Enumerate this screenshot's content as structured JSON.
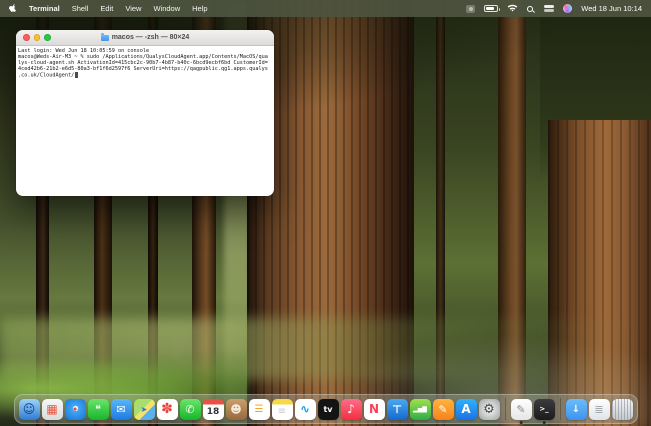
{
  "menu_bar": {
    "menus": [
      "Terminal",
      "Shell",
      "Edit",
      "View",
      "Window",
      "Help"
    ],
    "clock": "Wed 18 Jun 10:14",
    "status_icons": [
      "menu-extra",
      "battery",
      "wifi",
      "spotlight",
      "control-center",
      "siri"
    ]
  },
  "terminal_window": {
    "title": "macos — -zsh — 80×24",
    "lines": [
      "Last login: Wed Jun 18 10:05:59 on console",
      "macos@Weds-Air-M3 ~ % sudo /Applications/QualysCloudAgent.app/Contents/MacOS/qua",
      "lys-cloud-agent.sh ActivationId=415cbc2c-90b7-4b87-b40c-6bcd9ecbf6bd CustomerId=",
      "4ced42b6-21b2-e6d5-80a3-bf1f6d2597f6 ServerUri=https://qagpublic.qg1.apps.qualys",
      ".co.uk/CloudAgent/"
    ],
    "cursor_visible": true
  },
  "colors": {
    "menubar_bg": "#4e543f",
    "traffic_red": "#ff5f57",
    "traffic_yellow": "#febc2e",
    "traffic_green": "#28c840",
    "terminal_text": "#161616"
  },
  "dock": {
    "items": [
      {
        "name": "finder",
        "glyph": "☺",
        "bg": "linear-gradient(180deg,#9fd2f7,#2e7cd6)",
        "fg": "#0b3f7e",
        "fs": 12
      },
      {
        "name": "launchpad",
        "glyph": "▦",
        "bg": "linear-gradient(180deg,#f7f7f7,#d9dadc)",
        "fg": "#e8563f",
        "fs": 12
      },
      {
        "name": "safari",
        "glyph": "✦",
        "bg": "radial-gradient(circle at 50% 45%,#eaf6ff 16%,#3fa9f5 18%,#1a6fd4)",
        "fg": "#e8453c",
        "fs": 8
      },
      {
        "name": "messages",
        "glyph": "❝",
        "bg": "linear-gradient(180deg,#6be36b,#15b729)",
        "fg": "#ffffff",
        "fs": 11
      },
      {
        "name": "mail",
        "glyph": "✉",
        "bg": "linear-gradient(180deg,#59b6f8,#1d7ae4)",
        "fg": "#ffffff",
        "fs": 11
      },
      {
        "name": "maps",
        "glyph": "➤",
        "bg": "linear-gradient(135deg,#a9dd6d 45%,#f3e26b 45%,#f3e26b 62%,#59b1f2 62%)",
        "fg": "#2f6fe4",
        "fs": 8
      },
      {
        "name": "photos",
        "glyph": "✽",
        "bg": "#ffffff",
        "fg": "#e8453c",
        "fs": 14
      },
      {
        "name": "facetime",
        "glyph": "✆",
        "bg": "linear-gradient(180deg,#6be36b,#15b729)",
        "fg": "#ffffff",
        "fs": 11
      },
      {
        "name": "calendar",
        "glyph": "18",
        "bg": "linear-gradient(180deg,#ec5044 0,#ec5044 26%,#ffffff 26%)",
        "fg": "#333333",
        "fs": 9,
        "pad": 5,
        "bold": true
      },
      {
        "name": "contacts",
        "glyph": "☻",
        "bg": "linear-gradient(180deg,#cb9e6b,#96683c)",
        "fg": "#f4e9d8",
        "fs": 11
      },
      {
        "name": "reminders",
        "glyph": "☰",
        "bg": "#ffffff",
        "fg": "#f5a623",
        "fs": 10
      },
      {
        "name": "notes",
        "glyph": "≡",
        "bg": "linear-gradient(180deg,#f7d947 0,#f7d947 27%,#ffffff 27%)",
        "fg": "#c9c9c9",
        "fs": 10,
        "pad": 4
      },
      {
        "name": "freeform",
        "glyph": "∿",
        "bg": "#ffffff",
        "fg": "#18a0ea",
        "fs": 12,
        "bold": true
      },
      {
        "name": "tv",
        "glyph": "tv",
        "bg": "#141414",
        "fg": "#ffffff",
        "fs": 8,
        "bold": true
      },
      {
        "name": "music",
        "glyph": "♪",
        "bg": "linear-gradient(180deg,#fd6e8a,#f52d3f)",
        "fg": "#ffffff",
        "fs": 12
      },
      {
        "name": "news",
        "glyph": "N",
        "bg": "#ffffff",
        "fg": "#fb415b",
        "fs": 12,
        "bold": true
      },
      {
        "name": "keynote",
        "glyph": "⊤",
        "bg": "linear-gradient(180deg,#4aa8f2,#1469cc)",
        "fg": "#ffffff",
        "fs": 11,
        "bold": true
      },
      {
        "name": "numbers",
        "glyph": "▂▅▇",
        "bg": "linear-gradient(180deg,#9ee04f,#2fae45)",
        "fg": "#ffffff",
        "fs": 6
      },
      {
        "name": "pages",
        "glyph": "✎",
        "bg": "linear-gradient(180deg,#ffb340,#f7821b)",
        "fg": "#ffffff",
        "fs": 11
      },
      {
        "name": "appstore",
        "glyph": "A",
        "bg": "linear-gradient(180deg,#30b0fb,#1a71e8)",
        "fg": "#ffffff",
        "fs": 12,
        "bold": true
      },
      {
        "name": "settings",
        "glyph": "⚙",
        "bg": "radial-gradient(circle,#ececec 15%,#9fa0a2)",
        "fg": "#4a4a4a",
        "fs": 13
      },
      {
        "divider": true
      },
      {
        "name": "textedit",
        "glyph": "✎",
        "bg": "linear-gradient(180deg,#ffffff,#e6e6e6)",
        "fg": "#8a8a8a",
        "fs": 11,
        "running": true
      },
      {
        "name": "terminal",
        "glyph": ">_",
        "bg": "linear-gradient(180deg,#3c3c3e,#1b1b1d)",
        "fg": "#ffffff",
        "fs": 7,
        "bold": true,
        "running": true
      },
      {
        "divider": true
      },
      {
        "name": "downloads-folder",
        "glyph": "↓",
        "bg": "linear-gradient(180deg,#6cbcf9,#3c93ef)",
        "fg": "#ffffff",
        "fs": 10,
        "bold": true
      },
      {
        "name": "documents-stack",
        "glyph": "≣",
        "bg": "linear-gradient(180deg,#ffffff,#dfe3e8)",
        "fg": "#9aa0a8",
        "fs": 11
      },
      {
        "name": "trash",
        "glyph": " ",
        "bg": "repeating-linear-gradient(90deg,rgba(130,135,142,0.55) 0,rgba(130,135,142,0.55) 1px,rgba(255,255,255,0) 1px,rgba(255,255,255,0) 3px),linear-gradient(180deg,#f2f3f5,#c4c9cf)",
        "fg": "#999999",
        "fs": 10
      }
    ]
  }
}
